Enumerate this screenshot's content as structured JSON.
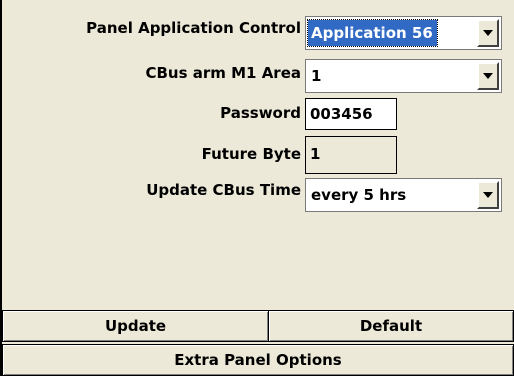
{
  "form": {
    "panel_app_label": "Panel Application Control",
    "panel_app_value": "Application 56",
    "cbus_area_label": "CBus arm M1 Area",
    "cbus_area_value": "1",
    "password_label": "Password",
    "password_value": "003456",
    "future_byte_label": "Future Byte",
    "future_byte_value": "1",
    "update_time_label": "Update CBus Time",
    "update_time_value": "every 5 hrs"
  },
  "buttons": {
    "update": "Update",
    "default": "Default",
    "extra": "Extra Panel Options"
  },
  "colors": {
    "background": "#ece9d8",
    "selection": "#316ac5"
  }
}
